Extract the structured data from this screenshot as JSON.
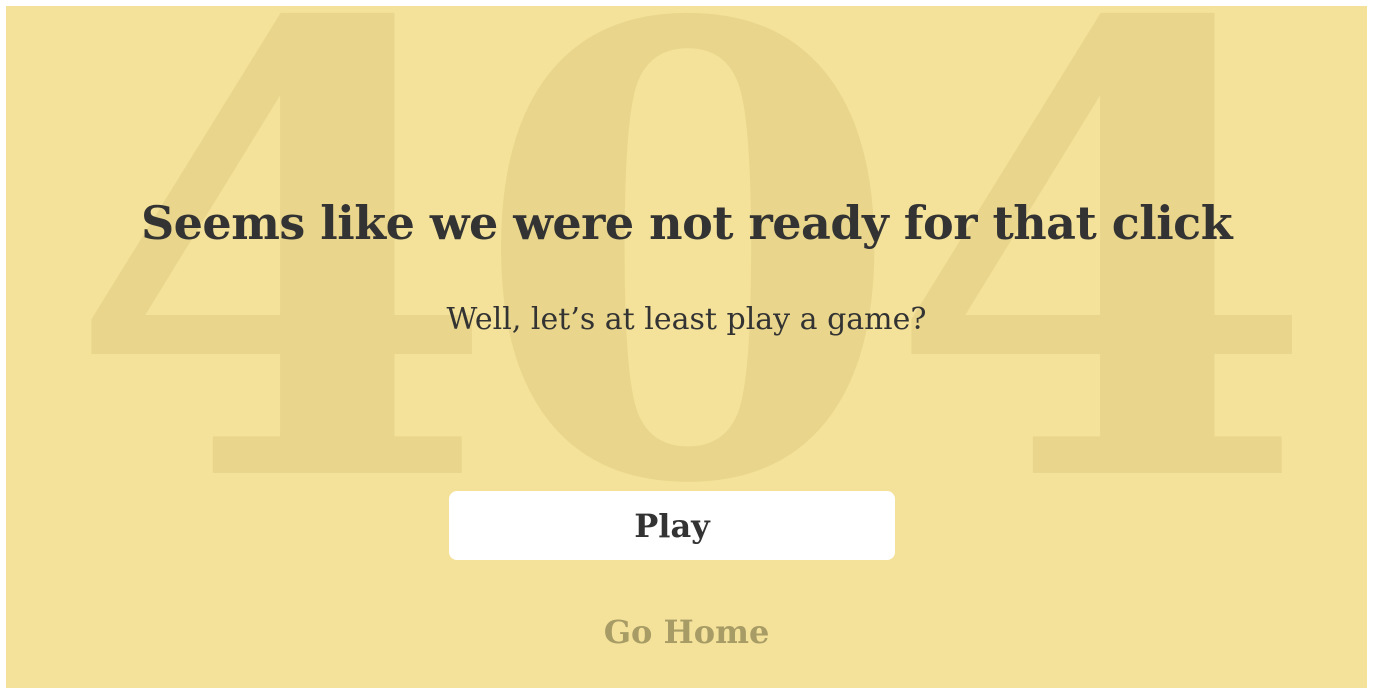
{
  "background": {
    "digits": [
      "4",
      "0",
      "4"
    ],
    "color": "#f4e29a",
    "digit_color": "#e9d68c"
  },
  "main": {
    "headline": "Seems like we were not ready for that click",
    "subhead": "Well, let’s at least play a game?",
    "play_label": "Play",
    "home_label": "Go Home"
  },
  "colors": {
    "text": "#333333",
    "button_bg": "#ffffff",
    "link": "#a89c66"
  }
}
